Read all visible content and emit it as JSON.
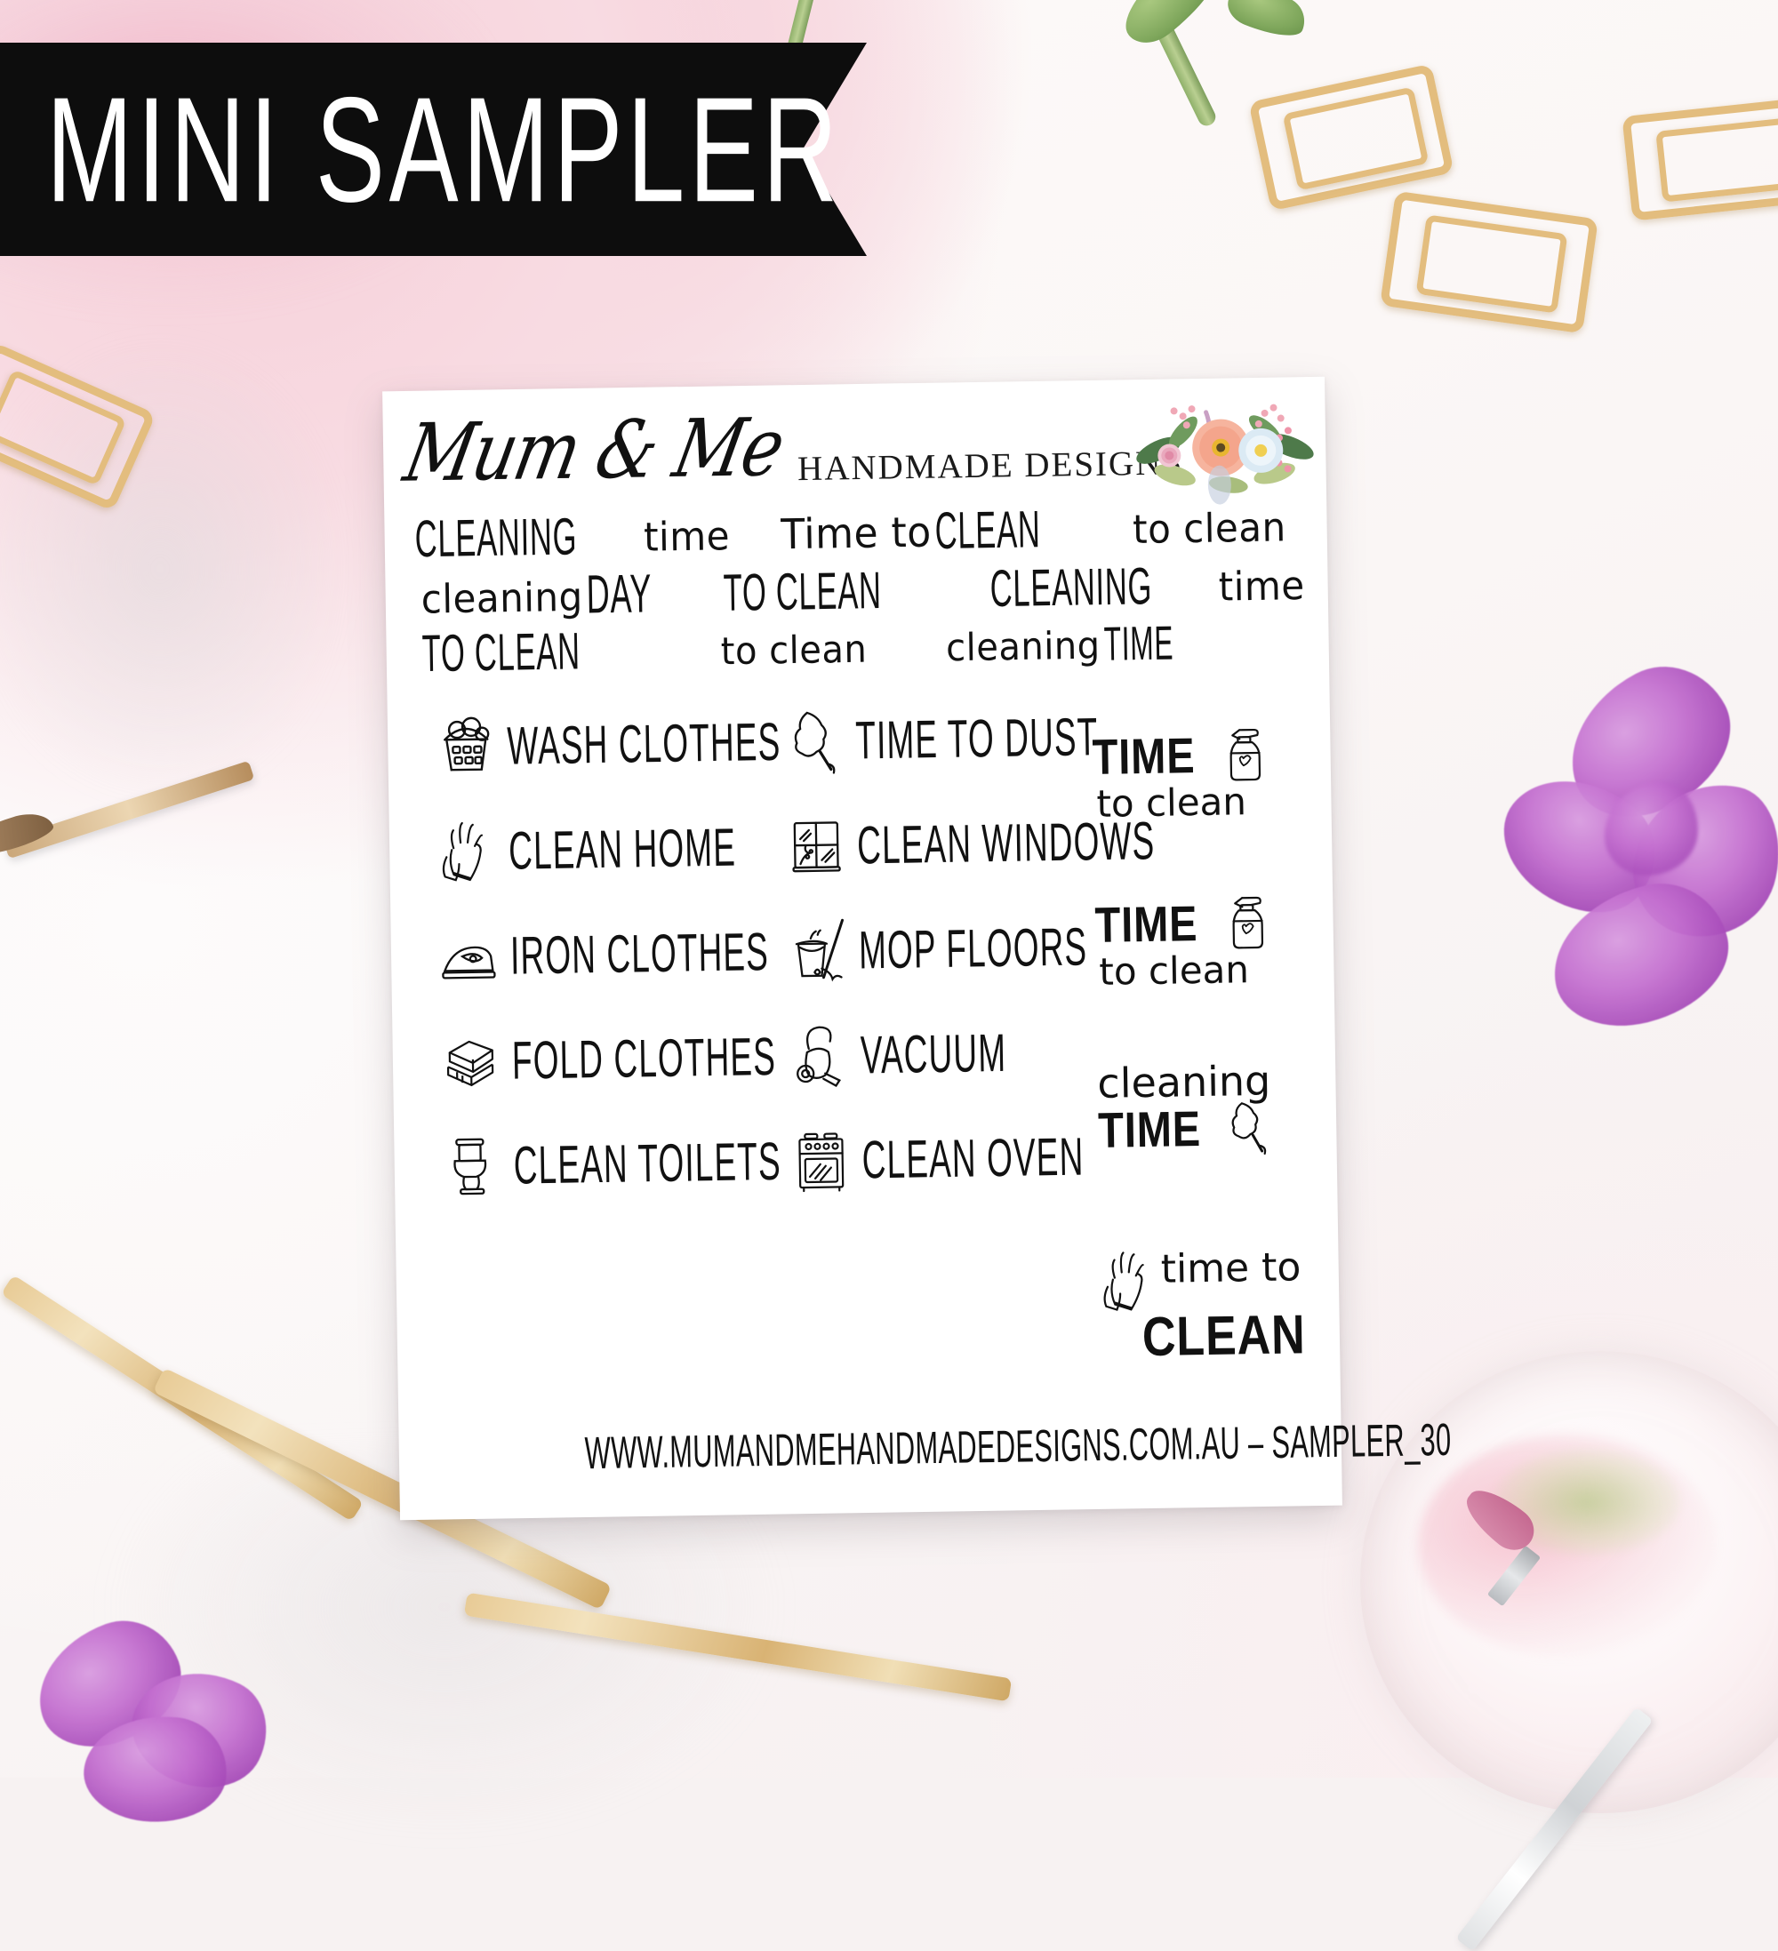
{
  "banner": {
    "title": "MINI SAMPLER",
    "bg_color": "#0d0d0d",
    "text_color": "#ffffff"
  },
  "sheet": {
    "logo": {
      "script": "Mum & Me",
      "tagline": "HANDMADE DESIGNS",
      "flower_icon": "watercolor-floral-bouquet"
    },
    "phrase_rows": [
      [
        {
          "id": "cleaning-time-1",
          "parts": [
            {
              "text": "CLEANING",
              "style": "tallcaps"
            },
            {
              "text": "time",
              "style": "roundhand"
            }
          ]
        },
        {
          "id": "time-to-clean-1",
          "parts": [
            {
              "text": "Time to",
              "style": "roundhand"
            },
            {
              "text": "CLEAN",
              "style": "tallcaps"
            }
          ]
        },
        {
          "id": "to-clean-1",
          "parts": [
            {
              "text": "to clean",
              "style": "roundhand"
            }
          ]
        }
      ],
      [
        {
          "id": "cleaning-day",
          "parts": [
            {
              "text": "cleaning",
              "style": "roundhand"
            },
            {
              "text": "DAY",
              "style": "tallcaps"
            }
          ]
        },
        {
          "id": "to-clean-caps-1",
          "parts": [
            {
              "text": "TO CLEAN",
              "style": "tallcaps"
            }
          ]
        },
        {
          "id": "cleaning-time-2",
          "parts": [
            {
              "text": "CLEANING",
              "style": "tallcaps"
            },
            {
              "text": "time",
              "style": "roundhand"
            }
          ]
        }
      ],
      [
        {
          "id": "to-clean-caps-2",
          "parts": [
            {
              "text": "TO CLEAN",
              "style": "tallcaps"
            }
          ]
        },
        {
          "id": "to-clean-2",
          "parts": [
            {
              "text": "to clean",
              "style": "roundhand"
            }
          ]
        },
        {
          "id": "cleaning-time-3",
          "parts": [
            {
              "text": "cleaning",
              "style": "roundhand"
            },
            {
              "text": "TIME",
              "style": "tallcaps"
            }
          ]
        }
      ]
    ],
    "task_rows": [
      {
        "left": {
          "label": "WASH CLOTHES",
          "icon": "laundry-basket-icon"
        },
        "right": {
          "label": "TIME TO DUST",
          "icon": "feather-duster-icon"
        }
      },
      {
        "left": {
          "label": "CLEAN HOME",
          "icon": "rubber-gloves-icon"
        },
        "right": {
          "label": "CLEAN WINDOWS",
          "icon": "window-icon"
        }
      },
      {
        "left": {
          "label": "IRON CLOTHES",
          "icon": "iron-icon"
        },
        "right": {
          "label": "MOP FLOORS",
          "icon": "bucket-mop-icon"
        }
      },
      {
        "left": {
          "label": "FOLD CLOTHES",
          "icon": "folded-clothes-icon"
        },
        "right": {
          "label": "VACUUM",
          "icon": "vacuum-cleaner-icon"
        }
      },
      {
        "left": {
          "label": "CLEAN TOILETS",
          "icon": "toilet-icon"
        },
        "right": {
          "label": "CLEAN OVEN",
          "icon": "oven-icon"
        }
      }
    ],
    "right_column": [
      {
        "id": "time-to-clean-spray-1",
        "line1": "TIME",
        "line2": "to clean",
        "icon": "spray-bottle-icon"
      },
      {
        "id": "time-to-clean-spray-2",
        "line1": "TIME",
        "line2": "to clean",
        "icon": "spray-bottle-icon"
      },
      {
        "id": "cleaning-time-duster",
        "line1": "cleaning",
        "line2": "TIME",
        "icon": "feather-duster-icon"
      },
      {
        "id": "time-to-clean-gloves",
        "line1": "time to",
        "line2": "CLEAN",
        "icon": "rubber-gloves-icon"
      }
    ],
    "footer_url": "WWW.MUMANDMEHANDMADEDESIGNS.COM.AU – SAMPLER_30"
  },
  "background": {
    "description": "flat-lay photo background",
    "props": [
      "gold-paperclip",
      "gold-pen",
      "purple-flower",
      "watercolor-paint-dish",
      "paintbrush",
      "green-stem"
    ],
    "base_color": "#fbf7f6",
    "pink_accent": "#f2b9c9",
    "gold_accent": "#e3bd7e",
    "purple_accent": "#b45fc4"
  }
}
